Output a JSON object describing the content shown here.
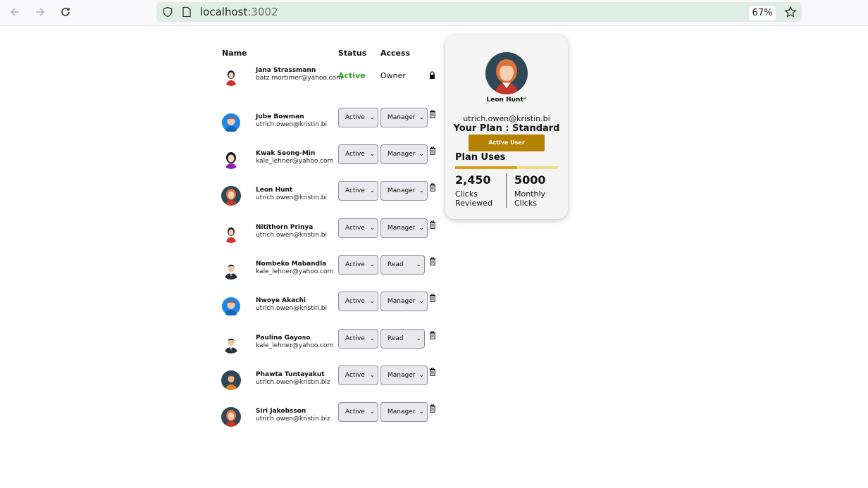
{
  "browser": {
    "url_host": "localhost",
    "url_port": ":3002",
    "zoom": "67%"
  },
  "table": {
    "headers": {
      "name": "Name",
      "status": "Status",
      "access": "Access"
    },
    "owner": {
      "name": "Jana Strassmann",
      "email": "batz.mortimer@yahoo.com",
      "status": "Active",
      "access": "Owner"
    },
    "rows": [
      {
        "name": "Jube Bowman",
        "email": "utrich.owen@kristin.bi",
        "status": "Active",
        "access": "Manager",
        "avatar": "boy-red-hair"
      },
      {
        "name": "Kwak Seong-Min",
        "email": "kale_lehner@yahoo.com",
        "status": "Active",
        "access": "Manager",
        "avatar": "girl-purple"
      },
      {
        "name": "Leon Hunt",
        "email": "utrich.owen@kristin.bi",
        "status": "Active",
        "access": "Manager",
        "avatar": "woman-orange-hair"
      },
      {
        "name": "Nitithorn Prinya",
        "email": "utrich.owen@kristin.bi",
        "status": "Active",
        "access": "Manager",
        "avatar": "woman-red-top"
      },
      {
        "name": "Nombeko Mabandla",
        "email": "kale_lehner@yahoo.com",
        "status": "Active",
        "access": "Read",
        "avatar": "man-suit"
      },
      {
        "name": "Nwoye Akachi",
        "email": "utrich.owen@kristin.bi",
        "status": "Active",
        "access": "Manager",
        "avatar": "boy-red-hair"
      },
      {
        "name": "Paulina Gayoso",
        "email": "kale_lehner@yahoo.com",
        "status": "Active",
        "access": "Read",
        "avatar": "man-suit"
      },
      {
        "name": "Phawta Tuntayakut",
        "email": "utrich.owen@kristin.biz",
        "status": "Active",
        "access": "Manager",
        "avatar": "man-beard"
      },
      {
        "name": "Siri Jakobsson",
        "email": "utrich.owen@kristin.biz",
        "status": "Active",
        "access": "Manager",
        "avatar": "woman-orange-hair"
      }
    ]
  },
  "profile": {
    "name": "Leon Hunt",
    "star": "*",
    "email": "utrich.owen@kristin.bi",
    "plan": "Your Plan : Standard",
    "button": "Active User",
    "uses_title": "Plan Uses",
    "usage_fraction": 0.6,
    "clicks_reviewed_value": "2,450",
    "clicks_reviewed_label": "Clicks Reviewed",
    "monthly_clicks_value": "5000",
    "monthly_clicks_label": "Monthly Clicks"
  },
  "colors": {
    "active_green": "#2a9d1e",
    "button_gold": "#b58200",
    "bar_fill": "#d9a21c",
    "bar_track": "#f2dd8a"
  }
}
